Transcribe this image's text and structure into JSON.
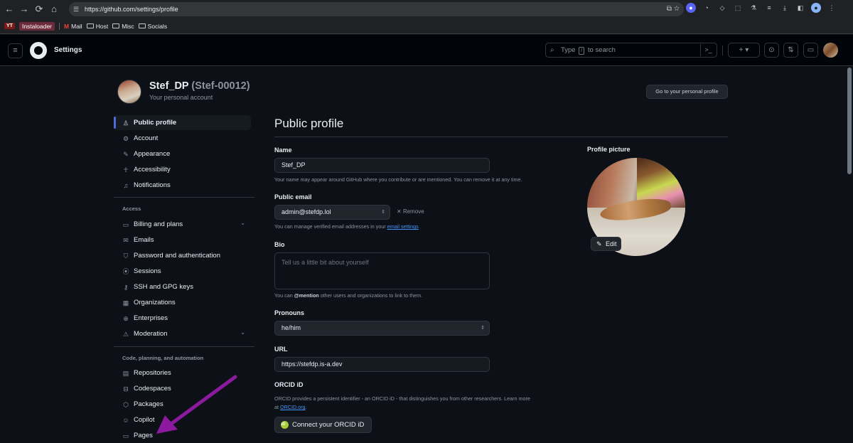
{
  "browser": {
    "url": "https://github.com/settings/profile",
    "bookmarks": [
      "YT",
      "Instaloader",
      "Mail",
      "Host",
      "Misc",
      "Socials"
    ]
  },
  "header": {
    "title": "Settings",
    "search_prefix": "Type",
    "search_key": "/",
    "search_suffix": "to search",
    "search_cmd": ">_",
    "add": "+ ▾"
  },
  "account": {
    "name": "Stef_DP",
    "handle": "(Stef-00012)",
    "subtitle": "Your personal account",
    "goto_button": "Go to your personal profile"
  },
  "sidebar": {
    "items": [
      {
        "label": "Public profile",
        "icon": "person-icon"
      },
      {
        "label": "Account",
        "icon": "gear-icon"
      },
      {
        "label": "Appearance",
        "icon": "paintbrush-icon"
      },
      {
        "label": "Accessibility",
        "icon": "accessibility-icon"
      },
      {
        "label": "Notifications",
        "icon": "bell-icon"
      }
    ],
    "access_heading": "Access",
    "access_items": [
      {
        "label": "Billing and plans",
        "icon": "credit-card-icon"
      },
      {
        "label": "Emails",
        "icon": "mail-icon"
      },
      {
        "label": "Password and authentication",
        "icon": "shield-lock-icon"
      },
      {
        "label": "Sessions",
        "icon": "broadcast-icon"
      },
      {
        "label": "SSH and GPG keys",
        "icon": "key-icon"
      },
      {
        "label": "Organizations",
        "icon": "organization-icon"
      },
      {
        "label": "Enterprises",
        "icon": "globe-icon"
      },
      {
        "label": "Moderation",
        "icon": "report-icon"
      }
    ],
    "code_heading": "Code, planning, and automation",
    "code_items": [
      {
        "label": "Repositories",
        "icon": "repo-icon"
      },
      {
        "label": "Codespaces",
        "icon": "codespaces-icon"
      },
      {
        "label": "Packages",
        "icon": "package-icon"
      },
      {
        "label": "Copilot",
        "icon": "copilot-icon"
      },
      {
        "label": "Pages",
        "icon": "browser-icon"
      }
    ]
  },
  "main": {
    "title": "Public profile",
    "name_label": "Name",
    "name_value": "Stef_DP",
    "name_note": "Your name may appear around GitHub where you contribute or are mentioned. You can remove it at any time.",
    "email_label": "Public email",
    "email_value": "admin@stefdp.lol",
    "remove_label": "Remove",
    "email_note_prefix": "You can manage verified email addresses in your",
    "email_note_link": "email settings",
    "bio_label": "Bio",
    "bio_placeholder": "Tell us a little bit about yourself",
    "bio_note_prefix": "You can",
    "bio_note_mention": "@mention",
    "bio_note_suffix": "other users and organizations to link to them.",
    "pronouns_label": "Pronouns",
    "pronouns_value": "he/him",
    "url_label": "URL",
    "url_value": "https://stefdp.is-a.dev",
    "orcid_label": "ORCID iD",
    "orcid_note_line1": "ORCID provides a persistent identifier - an ORCID iD - that distinguishes you from other researchers. Learn more",
    "orcid_note_at": "at",
    "orcid_note_link": "ORCID.org",
    "orcid_button": "Connect your ORCID iD"
  },
  "profile_picture": {
    "label": "Profile picture",
    "edit_label": "Edit"
  },
  "colors": {
    "background": "#0d1117",
    "accent": "#4f6bd8",
    "link": "#4493f8",
    "annotation_arrow": "#8b1a9e"
  }
}
